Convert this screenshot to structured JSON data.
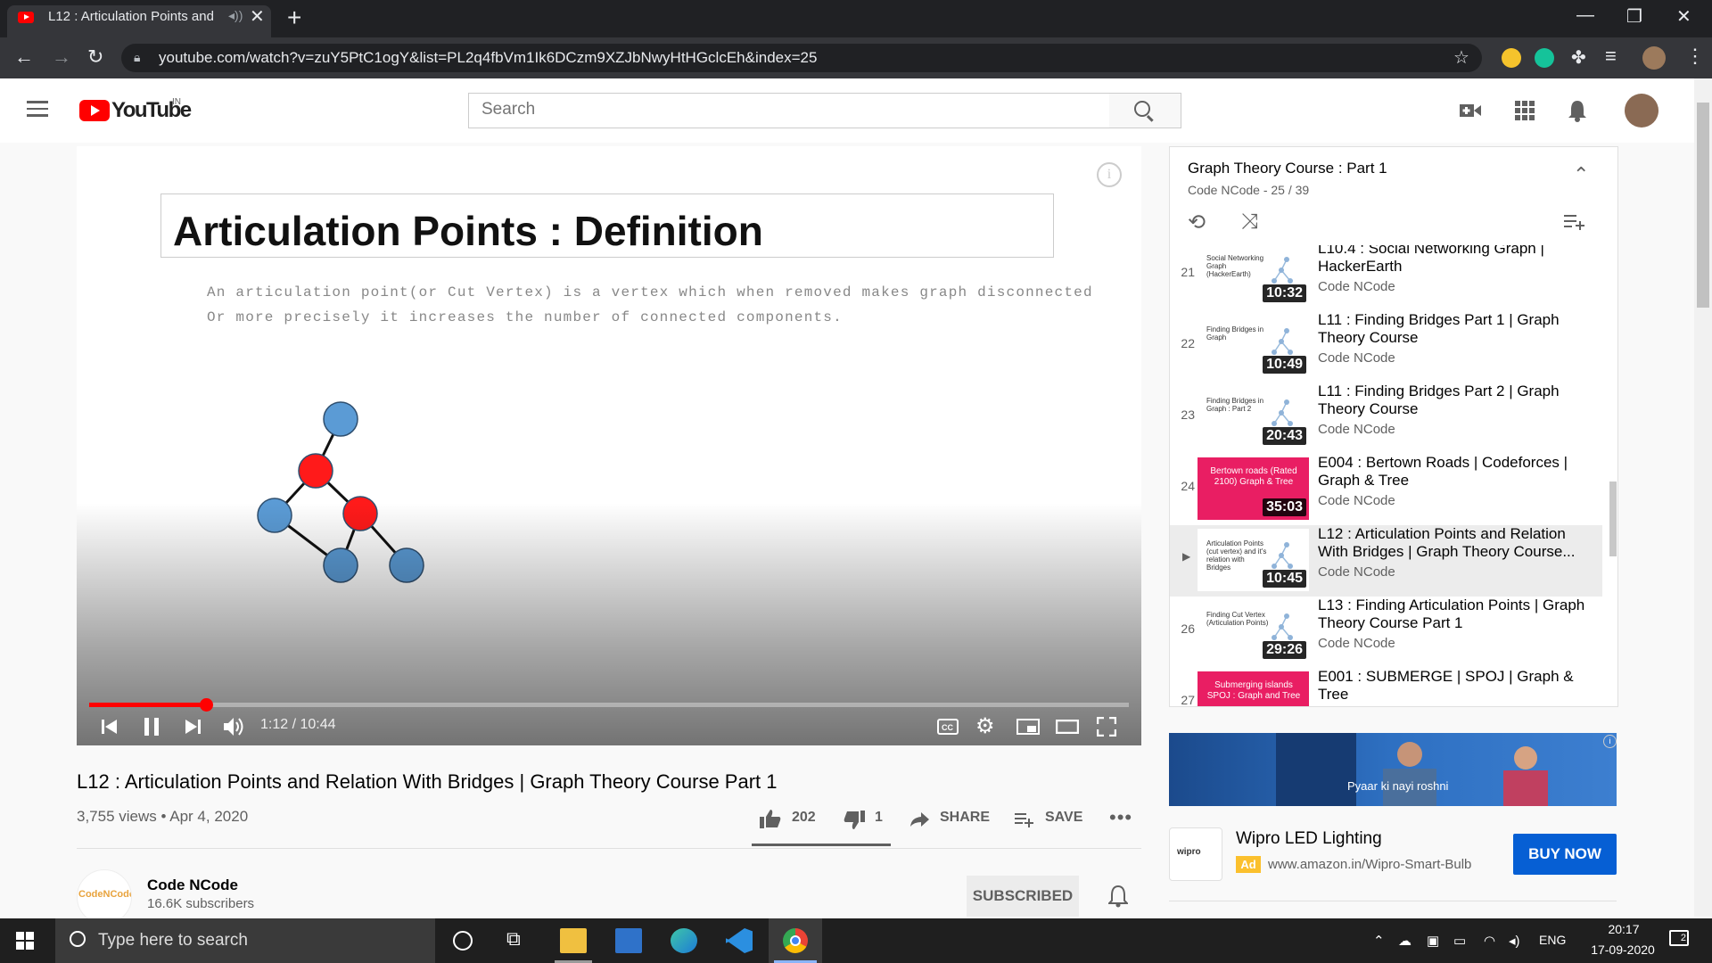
{
  "browser": {
    "tab_title": "L12 : Articulation Points and",
    "url": "youtube.com/watch?v=zuY5PtC1ogY&list=PL2q4fbVm1Ik6DCzm9XZJbNwyHtHGclcEh&index=25"
  },
  "header": {
    "logo_text": "YouTube",
    "region": "IN",
    "search_placeholder": "Search"
  },
  "video": {
    "slide_title": "Articulation Points : Definition",
    "slide_line1": "An articulation point(or Cut Vertex) is a vertex which when removed makes graph disconnected",
    "slide_line2": "Or more precisely it increases the number of connected components.",
    "time": "1:12 / 10:44",
    "progress": 0.112,
    "title": "L12 : Articulation Points and Relation With Bridges | Graph Theory Course Part 1",
    "views": "3,755 views",
    "date": "Apr 4, 2020",
    "likes": "202",
    "dislikes": "1",
    "share": "SHARE",
    "save": "SAVE"
  },
  "channel": {
    "name": "Code NCode",
    "subscribers": "16.6K subscribers",
    "subscribed_label": "SUBSCRIBED",
    "avatar_text": "CodeNCode"
  },
  "playlist": {
    "title": "Graph Theory Course : Part 1",
    "subtitle": "Code NCode - 25 / 39",
    "items": [
      {
        "index": "21",
        "title": "L10.4 : Social Networking Graph | HackerEarth",
        "channel": "Code NCode",
        "duration": "10:32",
        "thumb": "Social Networking Graph (HackerEarth)",
        "style": "white"
      },
      {
        "index": "22",
        "title": "L11 : Finding Bridges Part 1 | Graph Theory Course",
        "channel": "Code NCode",
        "duration": "10:49",
        "thumb": "Finding Bridges in Graph",
        "style": "white"
      },
      {
        "index": "23",
        "title": "L11 : Finding Bridges Part 2 | Graph Theory Course",
        "channel": "Code NCode",
        "duration": "20:43",
        "thumb": "Finding Bridges in Graph : Part 2",
        "style": "white"
      },
      {
        "index": "24",
        "title": "E004 : Bertown Roads | Codeforces | Graph & Tree",
        "channel": "Code NCode",
        "duration": "35:03",
        "thumb": "Bertown roads (Rated 2100) Graph & Tree",
        "style": "pink"
      },
      {
        "index": "",
        "title": "L12 : Articulation Points and Relation With Bridges | Graph Theory Course...",
        "channel": "Code NCode",
        "duration": "10:45",
        "thumb": "Articulation Points (cut vertex) and it's relation with Bridges",
        "style": "white",
        "current": true
      },
      {
        "index": "26",
        "title": "L13 : Finding Articulation Points | Graph Theory Course Part 1",
        "channel": "Code NCode",
        "duration": "29:26",
        "thumb": "Finding Cut Vertex (Articulation Points)",
        "style": "white"
      },
      {
        "index": "27",
        "title": "E001 : SUBMERGE | SPOJ | Graph & Tree",
        "channel": "",
        "duration": "",
        "thumb": "Submerging islands SPOJ : Graph and Tree",
        "style": "pink"
      }
    ]
  },
  "ad": {
    "banner_text": "Pyaar ki nayi roshni",
    "logo_text": "wipro",
    "title": "Wipro LED Lighting",
    "badge": "Ad",
    "url": "www.amazon.in/Wipro-Smart-Bulb",
    "cta": "BUY NOW"
  },
  "taskbar": {
    "search_text": "Type here to search",
    "lang": "ENG",
    "time": "20:17",
    "date": "17-09-2020",
    "notifications": "2"
  },
  "colors": {
    "brand_red": "#ff0000",
    "node_red": "#ff1a1a",
    "node_blue": "#5b9bd5",
    "cta_blue": "#065fd4"
  }
}
